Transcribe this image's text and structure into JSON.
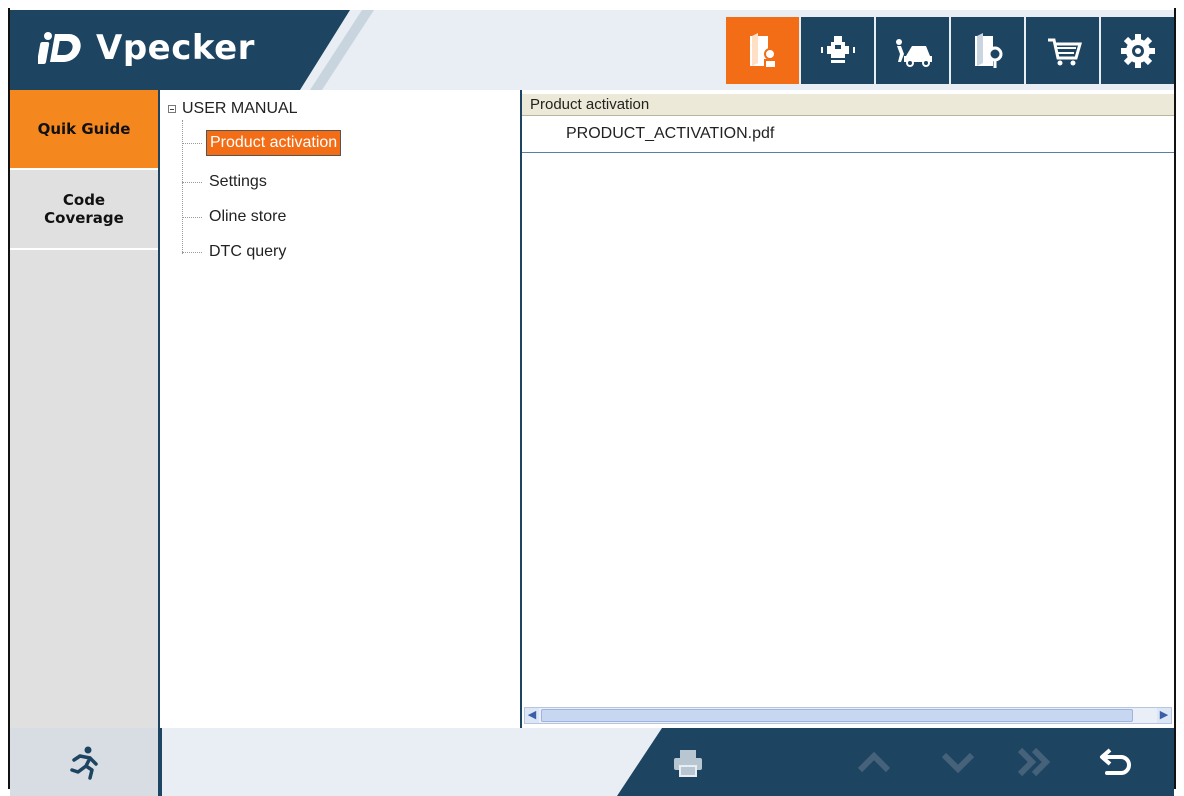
{
  "app": {
    "brand": "Vpecker",
    "logo_icon": "vpecker-logo-icon"
  },
  "toolbar": {
    "buttons": [
      {
        "name": "user-manual-icon",
        "active": true
      },
      {
        "name": "diagnosis-icon",
        "active": false
      },
      {
        "name": "car-repair-icon",
        "active": false
      },
      {
        "name": "search-book-icon",
        "active": false
      },
      {
        "name": "shopping-cart-icon",
        "active": false
      },
      {
        "name": "gear-icon",
        "active": false
      }
    ]
  },
  "sidebar": {
    "tabs": [
      {
        "label": "Quik Guide",
        "active": true
      },
      {
        "label_line1": "Code",
        "label_line2": "Coverage",
        "active": false
      }
    ]
  },
  "tree": {
    "root": "USER MANUAL",
    "items": [
      {
        "label": "Product activation",
        "selected": true
      },
      {
        "label": "Settings",
        "selected": false
      },
      {
        "label": "Oline store",
        "selected": false
      },
      {
        "label": "DTC query",
        "selected": false
      }
    ]
  },
  "content": {
    "header": "Product activation",
    "files": [
      "PRODUCT_ACTIVATION.pdf"
    ]
  },
  "bottom": {
    "icons": [
      "exit-running-man-icon",
      "print-icon",
      "camera-icon",
      "chevron-up-icon",
      "chevron-down-icon",
      "double-chevron-right-icon",
      "back-arrow-icon"
    ]
  },
  "colors": {
    "navy": "#1d4461",
    "orange": "#f26d16",
    "sidebar_gray": "#e0e0e0"
  }
}
